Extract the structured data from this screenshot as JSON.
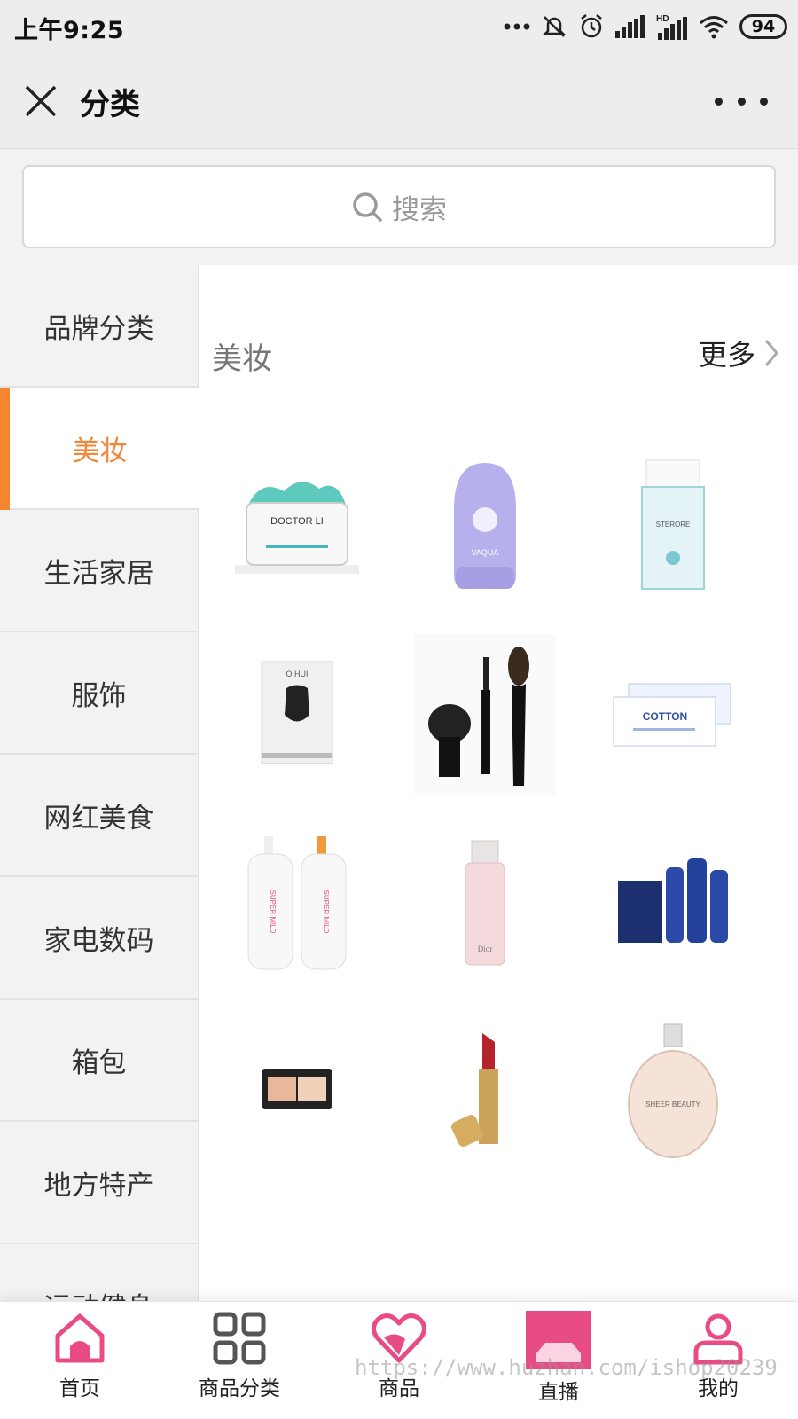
{
  "status_bar": {
    "time": "上午9:25",
    "battery": "94",
    "icons": [
      "more-dots-icon",
      "mute-icon",
      "alarm-icon",
      "cell-signal-icon",
      "hd-signal-icon",
      "wifi-icon",
      "battery-icon"
    ]
  },
  "nav": {
    "title": "分类",
    "close_icon": "close-icon",
    "more_icon": "more-icon"
  },
  "search": {
    "placeholder": "搜索",
    "icon": "search-icon"
  },
  "sidebar": {
    "items": [
      {
        "label": "品牌分类",
        "active": false
      },
      {
        "label": "美妆",
        "active": true
      },
      {
        "label": "生活家居",
        "active": false
      },
      {
        "label": "服饰",
        "active": false
      },
      {
        "label": "网红美食",
        "active": false
      },
      {
        "label": "家电数码",
        "active": false
      },
      {
        "label": "箱包",
        "active": false
      },
      {
        "label": "地方特产",
        "active": false
      },
      {
        "label": "运动健身",
        "active": false
      }
    ]
  },
  "main": {
    "category_title": "美妆",
    "more_label": "更多",
    "products": [
      {
        "label": "DOCTOR LI",
        "icon": "cream-jar-icon"
      },
      {
        "label": "VAQUA",
        "icon": "sunscreen-bottle-icon"
      },
      {
        "label": "STERORE",
        "icon": "perfume-bottle-icon"
      },
      {
        "label": "O HUI",
        "icon": "face-mask-icon"
      },
      {
        "label": "",
        "icon": "makeup-brush-set-icon"
      },
      {
        "label": "COTTON",
        "icon": "cotton-pads-icon"
      },
      {
        "label": "SUPER MILD",
        "icon": "shampoo-bottles-icon"
      },
      {
        "label": "Dior",
        "icon": "foundation-bottle-icon"
      },
      {
        "label": "",
        "icon": "mens-care-set-icon"
      },
      {
        "label": "",
        "icon": "powder-compact-icon"
      },
      {
        "label": "",
        "icon": "lipstick-icon"
      },
      {
        "label": "SHEER BEAUTY",
        "icon": "perfume-icon"
      }
    ]
  },
  "tabs": [
    {
      "label": "首页",
      "icon": "home-icon"
    },
    {
      "label": "商品分类",
      "icon": "grid-icon"
    },
    {
      "label": "商品",
      "icon": "heart-icon"
    },
    {
      "label": "直播",
      "icon": "live-icon"
    },
    {
      "label": "我的",
      "icon": "profile-icon"
    }
  ],
  "watermark": "https://www.huzhan.com/ishop20239",
  "colors": {
    "accent": "#f5862e",
    "tab_pink": "#e94c85",
    "background": "#f2f2f2"
  }
}
